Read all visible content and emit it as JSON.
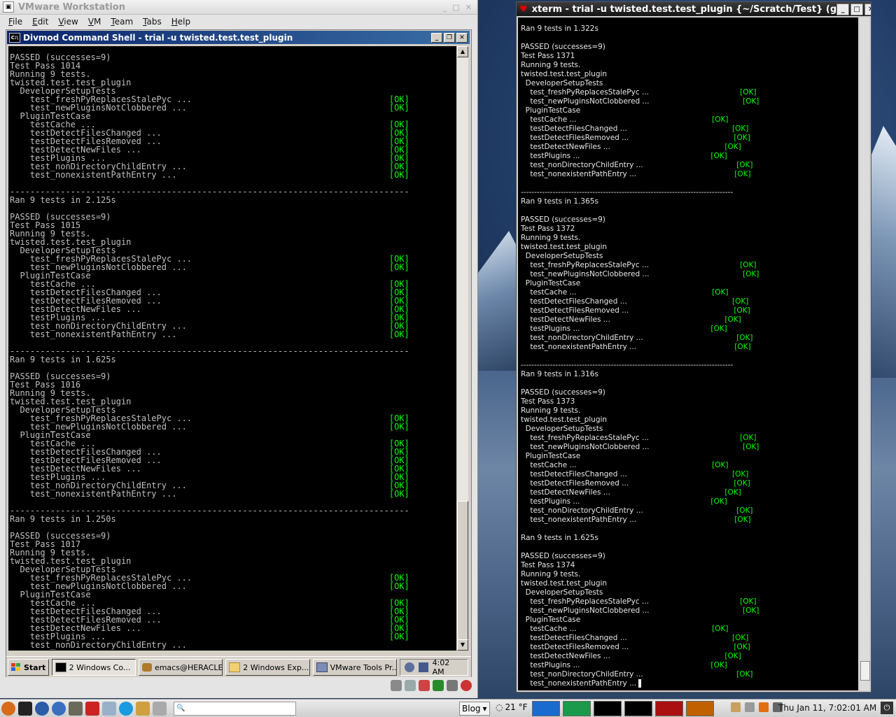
{
  "vmware": {
    "title": "VMware Workstation",
    "menu": [
      "File",
      "Edit",
      "View",
      "VM",
      "Team",
      "Tabs",
      "Help"
    ]
  },
  "cmd": {
    "title": "Divmod Command Shell - trial -u twisted.test.test_plugin",
    "lines": [
      [
        "PASSED (successes=9)",
        ""
      ],
      [
        "Test Pass 1014",
        ""
      ],
      [
        "Running 9 tests.",
        ""
      ],
      [
        "twisted.test.test_plugin",
        ""
      ],
      [
        "  DeveloperSetupTests",
        ""
      ],
      [
        "    test_freshPyReplacesStalePyc ...",
        "[OK]"
      ],
      [
        "    test_newPluginsNotClobbered ...",
        "[OK]"
      ],
      [
        "  PluginTestCase",
        ""
      ],
      [
        "    testCache ...",
        "[OK]"
      ],
      [
        "    testDetectFilesChanged ...",
        "[OK]"
      ],
      [
        "    testDetectFilesRemoved ...",
        "[OK]"
      ],
      [
        "    testDetectNewFiles ...",
        "[OK]"
      ],
      [
        "    testPlugins ...",
        "[OK]"
      ],
      [
        "    test_nonDirectoryChildEntry ...",
        "[OK]"
      ],
      [
        "    test_nonexistentPathEntry ...",
        "[OK]"
      ],
      [
        "",
        ""
      ],
      [
        "-------------------------------------------------------------------------------",
        ""
      ],
      [
        "Ran 9 tests in 2.125s",
        ""
      ],
      [
        "",
        ""
      ],
      [
        "PASSED (successes=9)",
        ""
      ],
      [
        "Test Pass 1015",
        ""
      ],
      [
        "Running 9 tests.",
        ""
      ],
      [
        "twisted.test.test_plugin",
        ""
      ],
      [
        "  DeveloperSetupTests",
        ""
      ],
      [
        "    test_freshPyReplacesStalePyc ...",
        "[OK]"
      ],
      [
        "    test_newPluginsNotClobbered ...",
        "[OK]"
      ],
      [
        "  PluginTestCase",
        ""
      ],
      [
        "    testCache ...",
        "[OK]"
      ],
      [
        "    testDetectFilesChanged ...",
        "[OK]"
      ],
      [
        "    testDetectFilesRemoved ...",
        "[OK]"
      ],
      [
        "    testDetectNewFiles ...",
        "[OK]"
      ],
      [
        "    testPlugins ...",
        "[OK]"
      ],
      [
        "    test_nonDirectoryChildEntry ...",
        "[OK]"
      ],
      [
        "    test_nonexistentPathEntry ...",
        "[OK]"
      ],
      [
        "",
        ""
      ],
      [
        "-------------------------------------------------------------------------------",
        ""
      ],
      [
        "Ran 9 tests in 1.625s",
        ""
      ],
      [
        "",
        ""
      ],
      [
        "PASSED (successes=9)",
        ""
      ],
      [
        "Test Pass 1016",
        ""
      ],
      [
        "Running 9 tests.",
        ""
      ],
      [
        "twisted.test.test_plugin",
        ""
      ],
      [
        "  DeveloperSetupTests",
        ""
      ],
      [
        "    test_freshPyReplacesStalePyc ...",
        "[OK]"
      ],
      [
        "    test_newPluginsNotClobbered ...",
        "[OK]"
      ],
      [
        "  PluginTestCase",
        ""
      ],
      [
        "    testCache ...",
        "[OK]"
      ],
      [
        "    testDetectFilesChanged ...",
        "[OK]"
      ],
      [
        "    testDetectFilesRemoved ...",
        "[OK]"
      ],
      [
        "    testDetectNewFiles ...",
        "[OK]"
      ],
      [
        "    testPlugins ...",
        "[OK]"
      ],
      [
        "    test_nonDirectoryChildEntry ...",
        "[OK]"
      ],
      [
        "    test_nonexistentPathEntry ...",
        "[OK]"
      ],
      [
        "",
        ""
      ],
      [
        "-------------------------------------------------------------------------------",
        ""
      ],
      [
        "Ran 9 tests in 1.250s",
        ""
      ],
      [
        "",
        ""
      ],
      [
        "PASSED (successes=9)",
        ""
      ],
      [
        "Test Pass 1017",
        ""
      ],
      [
        "Running 9 tests.",
        ""
      ],
      [
        "twisted.test.test_plugin",
        ""
      ],
      [
        "  DeveloperSetupTests",
        ""
      ],
      [
        "    test_freshPyReplacesStalePyc ...",
        "[OK]"
      ],
      [
        "    test_newPluginsNotClobbered ...",
        "[OK]"
      ],
      [
        "  PluginTestCase",
        ""
      ],
      [
        "    testCache ...",
        "[OK]"
      ],
      [
        "    testDetectFilesChanged ...",
        "[OK]"
      ],
      [
        "    testDetectFilesRemoved ...",
        "[OK]"
      ],
      [
        "    testDetectNewFiles ...",
        "[OK]"
      ],
      [
        "    testPlugins ...",
        "[OK]"
      ],
      [
        "    test_nonDirectoryChildEntry ...",
        ""
      ]
    ]
  },
  "guest_taskbar": {
    "start": "Start",
    "items": [
      "2 Windows Co...",
      "emacs@HERACLES",
      "2 Windows Exp...",
      "VMware Tools Pr..."
    ],
    "time": "4:02 AM"
  },
  "xterm": {
    "title": "xterm - trial -u twisted.test.test_plugin {~/Scratch/Test} (g",
    "lines": [
      [
        "Ran 9 tests in 1.322s",
        ""
      ],
      [
        "",
        ""
      ],
      [
        "PASSED (successes=9)",
        ""
      ],
      [
        "Test Pass 1371",
        ""
      ],
      [
        "Running 9 tests.",
        ""
      ],
      [
        "twisted.test.test_plugin",
        ""
      ],
      [
        "  DeveloperSetupTests",
        ""
      ],
      [
        "    test_freshPyReplacesStalePyc ...",
        "[OK]"
      ],
      [
        "    test_newPluginsNotClobbered ...",
        "[OK]"
      ],
      [
        "  PluginTestCase",
        ""
      ],
      [
        "    testCache ...",
        "[OK]"
      ],
      [
        "    testDetectFilesChanged ...",
        "[OK]"
      ],
      [
        "    testDetectFilesRemoved ...",
        "[OK]"
      ],
      [
        "    testDetectNewFiles ...",
        "[OK]"
      ],
      [
        "    testPlugins ...",
        "[OK]"
      ],
      [
        "    test_nonDirectoryChildEntry ...",
        "[OK]"
      ],
      [
        "    test_nonexistentPathEntry ...",
        "[OK]"
      ],
      [
        "",
        ""
      ],
      [
        "--------------------------------------------------------------------------------",
        ""
      ],
      [
        "Ran 9 tests in 1.365s",
        ""
      ],
      [
        "",
        ""
      ],
      [
        "PASSED (successes=9)",
        ""
      ],
      [
        "Test Pass 1372",
        ""
      ],
      [
        "Running 9 tests.",
        ""
      ],
      [
        "twisted.test.test_plugin",
        ""
      ],
      [
        "  DeveloperSetupTests",
        ""
      ],
      [
        "    test_freshPyReplacesStalePyc ...",
        "[OK]"
      ],
      [
        "    test_newPluginsNotClobbered ...",
        "[OK]"
      ],
      [
        "  PluginTestCase",
        ""
      ],
      [
        "    testCache ...",
        "[OK]"
      ],
      [
        "    testDetectFilesChanged ...",
        "[OK]"
      ],
      [
        "    testDetectFilesRemoved ...",
        "[OK]"
      ],
      [
        "    testDetectNewFiles ...",
        "[OK]"
      ],
      [
        "    testPlugins ...",
        "[OK]"
      ],
      [
        "    test_nonDirectoryChildEntry ...",
        "[OK]"
      ],
      [
        "    test_nonexistentPathEntry ...",
        "[OK]"
      ],
      [
        "",
        ""
      ],
      [
        "--------------------------------------------------------------------------------",
        ""
      ],
      [
        "Ran 9 tests in 1.316s",
        ""
      ],
      [
        "",
        ""
      ],
      [
        "PASSED (successes=9)",
        ""
      ],
      [
        "Test Pass 1373",
        ""
      ],
      [
        "Running 9 tests.",
        ""
      ],
      [
        "twisted.test.test_plugin",
        ""
      ],
      [
        "  DeveloperSetupTests",
        ""
      ],
      [
        "    test_freshPyReplacesStalePyc ...",
        "[OK]"
      ],
      [
        "    test_newPluginsNotClobbered ...",
        "[OK]"
      ],
      [
        "  PluginTestCase",
        ""
      ],
      [
        "    testCache ...",
        "[OK]"
      ],
      [
        "    testDetectFilesChanged ...",
        "[OK]"
      ],
      [
        "    testDetectFilesRemoved ...",
        "[OK]"
      ],
      [
        "    testDetectNewFiles ...",
        "[OK]"
      ],
      [
        "    testPlugins ...",
        "[OK]"
      ],
      [
        "    test_nonDirectoryChildEntry ...",
        "[OK]"
      ],
      [
        "    test_nonexistentPathEntry ...",
        "[OK]"
      ],
      [
        "",
        ""
      ],
      [
        "Ran 9 tests in 1.625s",
        ""
      ],
      [
        "",
        ""
      ],
      [
        "PASSED (successes=9)",
        ""
      ],
      [
        "Test Pass 1374",
        ""
      ],
      [
        "Running 9 tests.",
        ""
      ],
      [
        "twisted.test.test_plugin",
        ""
      ],
      [
        "  DeveloperSetupTests",
        ""
      ],
      [
        "    test_freshPyReplacesStalePyc ...",
        "[OK]"
      ],
      [
        "    test_newPluginsNotClobbered ...",
        "[OK]"
      ],
      [
        "  PluginTestCase",
        ""
      ],
      [
        "    testCache ...",
        "[OK]"
      ],
      [
        "    testDetectFilesChanged ...",
        "[OK]"
      ],
      [
        "    testDetectFilesRemoved ...",
        "[OK]"
      ],
      [
        "    testDetectNewFiles ...",
        "[OK]"
      ],
      [
        "    testPlugins ...",
        "[OK]"
      ],
      [
        "    test_nonDirectoryChildEntry ...",
        "[OK]"
      ],
      [
        "    test_nonexistentPathEntry ...",
        ""
      ]
    ]
  },
  "panel": {
    "blog": "Blog",
    "weather": "21 °F",
    "clock": "Thu Jan 11,  7:02:01 AM"
  },
  "colors": {
    "ok_green": "#00ff00",
    "xp_title": "#0a246a",
    "terminal_bg": "#000000"
  }
}
